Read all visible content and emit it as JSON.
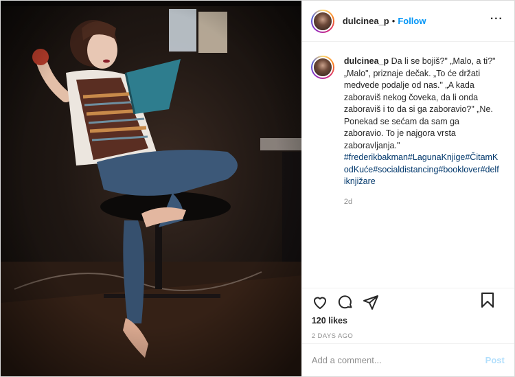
{
  "post": {
    "username": "dulcinea_p",
    "separator": "•",
    "follow_label": "Follow",
    "more_label": "···",
    "caption": {
      "username": "dulcinea_p",
      "text": "Da li se bojiš?\" „Malo, a ti?\" „Malo\", priznaje dečak. „To će držati medvede podalje od nas.\" „A kada zaboraviš nekog čoveka, da li onda zaboraviš i to da si ga zaboravio?\" „Ne. Ponekad se sećam da sam ga zaboravio. To je najgora vrsta zaboravljanja.\"",
      "hashtags": "#frederikbakman#LagunaKnjige#ČitamKodKuće#socialdistancing#booklover#delfiknjižare",
      "time": "2d"
    },
    "likes": "120 likes",
    "posted_ago": "2 DAYS AGO",
    "comment_placeholder": "Add a comment...",
    "post_button": "Post",
    "icons": [
      "heart-icon",
      "comment-icon",
      "share-icon",
      "bookmark-icon",
      "more-icon"
    ],
    "colors": {
      "link_blue": "#0095f6",
      "hashtag": "#00376b",
      "muted": "#8e8e8e",
      "post_disabled": "#b2dffc"
    }
  }
}
